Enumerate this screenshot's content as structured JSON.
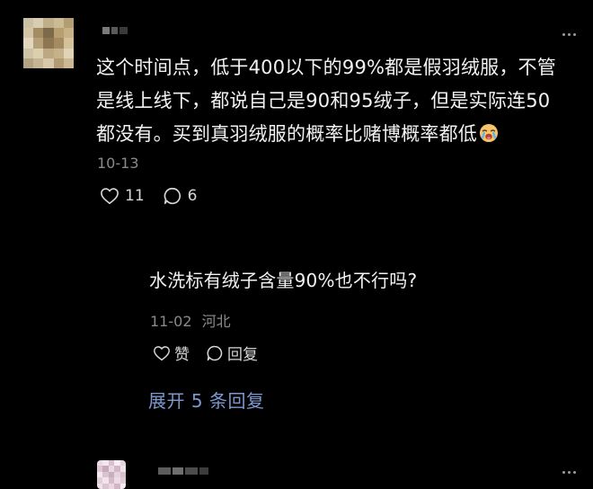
{
  "comment": {
    "username": "",
    "text": "这个时间点，低于400以下的99%都是假羽绒服，不管是线上线下，都说自己是90和95绒子，但是实际连50都没有。买到真羽绒服的概率比赌博概率都低",
    "emoji": "crying-face-emoji",
    "date": "10-13",
    "like_count": "11",
    "reply_count": "6"
  },
  "reply": {
    "username": "",
    "text": "水洗标有绒子含量90%也不行吗?",
    "date": "11-02",
    "location": "河北",
    "like_label": "赞",
    "reply_label": "回复"
  },
  "expand_replies_label": "展开 5 条回复",
  "colors": {
    "background": "#000000",
    "text": "#f2f2f2",
    "meta": "#8a8a8a",
    "link": "#7d97cf"
  }
}
